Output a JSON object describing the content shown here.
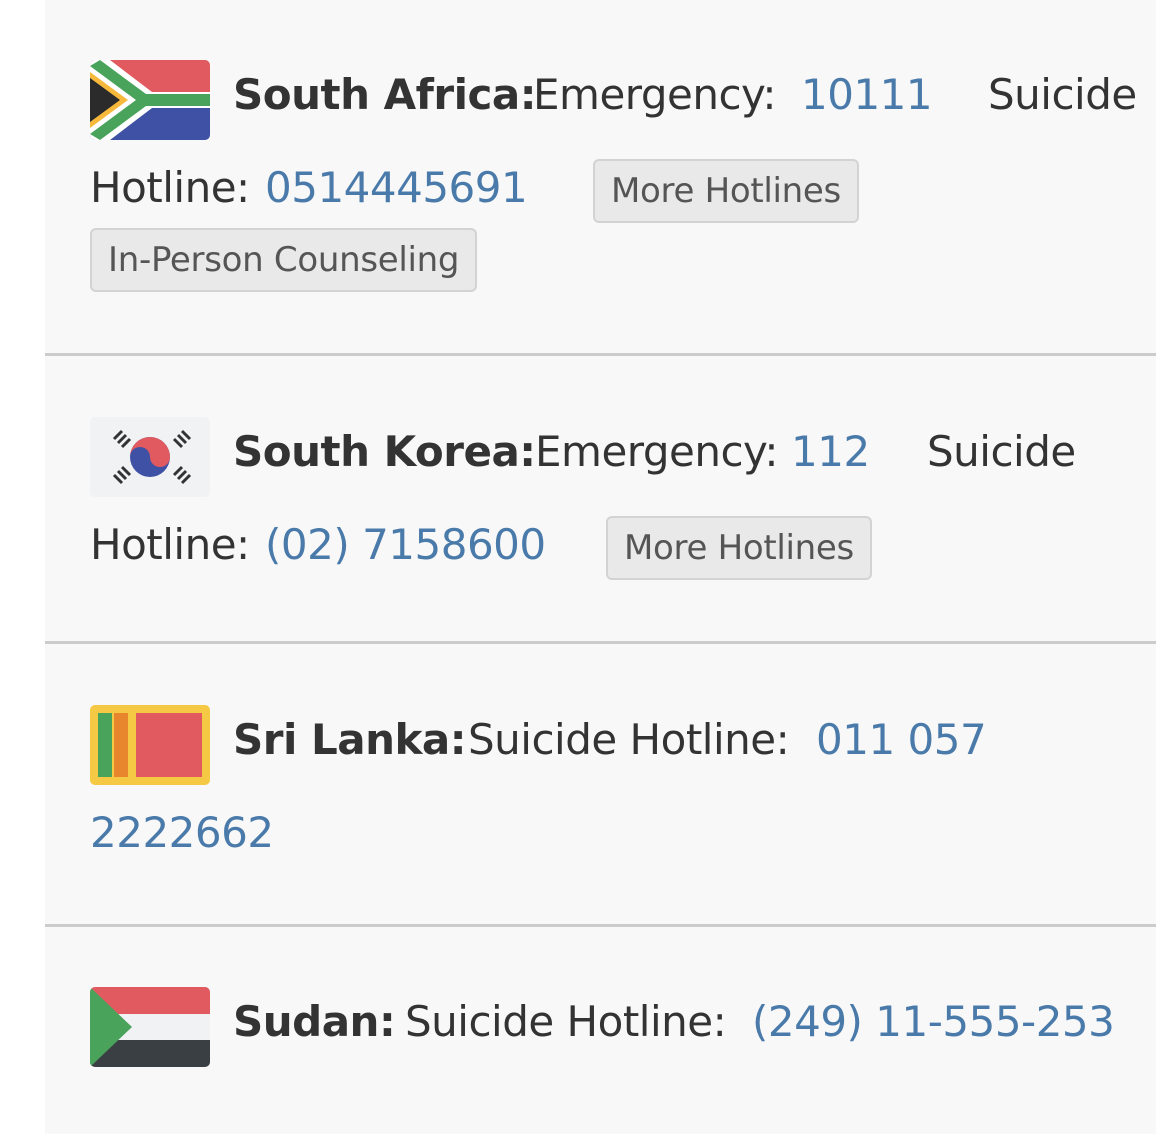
{
  "entries": [
    {
      "country": "South Africa:",
      "emergency_label": "Emergency:",
      "emergency_number": "10111",
      "hotline_label_part1": "Suicide",
      "hotline_label_part2": "Hotline:",
      "hotline_number": "0514445691",
      "buttons": [
        "More Hotlines",
        "In-Person Counseling"
      ],
      "flag_icon": "south-africa-flag"
    },
    {
      "country": "South Korea:",
      "emergency_label": "Emergency:",
      "emergency_number": "112",
      "hotline_label_part1": "Suicide",
      "hotline_label_part2": "Hotline:",
      "hotline_number": "(02) 7158600",
      "buttons": [
        "More Hotlines"
      ],
      "flag_icon": "south-korea-flag"
    },
    {
      "country": "Sri Lanka:",
      "hotline_label": "Suicide Hotline:",
      "hotline_number_part1": "011 057",
      "hotline_number_part2": "2222662",
      "flag_icon": "sri-lanka-flag"
    },
    {
      "country": "Sudan:",
      "hotline_label": "Suicide Hotline:",
      "hotline_number": "(249) 11-555-253",
      "flag_icon": "sudan-flag"
    }
  ],
  "colors": {
    "row_background": "#f8f8f8",
    "divider": "#cccccc",
    "link": "#4a7aaa",
    "text": "#333333",
    "button_bg": "#e9e9e9"
  }
}
